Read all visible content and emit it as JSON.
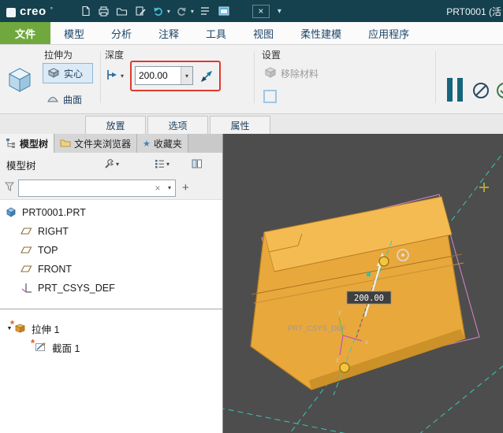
{
  "title_bar": {
    "logo_text": "creo",
    "logo_mark": "°",
    "doc_title": "PRT0001 (活"
  },
  "glyphs": {
    "dropdown": "▾",
    "close": "×",
    "clear": "×",
    "add": "+",
    "expander": "▼",
    "new_marker": "*",
    "star": "★"
  },
  "ribbon": {
    "file_tab": "文件",
    "tabs": [
      "模型",
      "分析",
      "注释",
      "工具",
      "视图",
      "柔性建模",
      "应用程序"
    ]
  },
  "dashboard": {
    "extrude_as_label": "拉伸为",
    "solid_label": "实心",
    "surface_label": "曲面",
    "depth_label": "深度",
    "depth_value": "200.00",
    "settings_label": "设置",
    "remove_material_label": "移除材料",
    "panel_tabs": [
      "放置",
      "选项",
      "属性"
    ]
  },
  "left_panel": {
    "tabs": [
      "模型树",
      "文件夹浏览器",
      "收藏夹"
    ],
    "header_title": "模型树",
    "filter_value": "",
    "tree": {
      "root": "PRT0001.PRT",
      "planes": [
        "RIGHT",
        "TOP",
        "FRONT"
      ],
      "csys": "PRT_CSYS_DEF",
      "extrude": "拉伸 1",
      "section": "截面 1"
    }
  },
  "viewport": {
    "dim_value": "200.00",
    "csys_label": "PRT_CSYS_DEF",
    "axis_labels": {
      "x": "x",
      "y": "y",
      "z": "z"
    },
    "colors": {
      "background": "#4d4d4d",
      "model": "#e9a83c",
      "model_top": "#f3bb52",
      "model_edge": "#a8731e",
      "centerline": "#3ac8b4",
      "sketch_outline": "#d886c8",
      "handle": "#f4c63d",
      "highlight_red": "#e0392e"
    }
  },
  "icons": {
    "new_file": "svg",
    "print": "svg",
    "open_folder": "svg",
    "edit_doc": "svg",
    "undo": "svg",
    "redo": "svg",
    "list": "svg",
    "window": "svg",
    "extrude_feature": "svg",
    "solid": "svg",
    "surface": "svg",
    "depth_blind": "svg",
    "flip_direction": "svg",
    "remove_material": "svg",
    "pause": "bars",
    "no_preview": "svg",
    "ok_check": "svg",
    "model_tree": "svg",
    "folder": "svg",
    "wrench": "svg",
    "columns": "svg",
    "funnel": "svg",
    "part": "svg",
    "datum_plane": "svg",
    "csys": "svg",
    "extrude": "svg",
    "sketch": "svg"
  }
}
